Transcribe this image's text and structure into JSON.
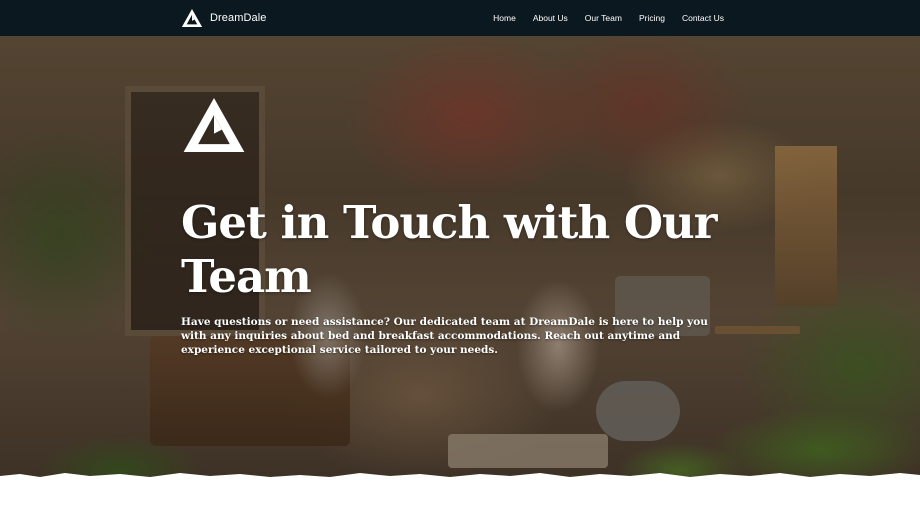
{
  "brand": {
    "name": "DreamDale",
    "logo_icon": "dreamdale-logo-icon"
  },
  "nav": {
    "links": [
      {
        "label": "Home"
      },
      {
        "label": "About Us"
      },
      {
        "label": "Our Team"
      },
      {
        "label": "Pricing"
      },
      {
        "label": "Contact Us"
      }
    ]
  },
  "hero": {
    "title": "Get in Touch with Our Team",
    "description": "Have questions or need assistance? Our dedicated team at DreamDale is here to help you with any inquiries about bed and breakfast accommodations. Reach out anytime and experience exceptional service tailored to your needs.",
    "background_description": "",
    "logo_icon": "dreamdale-logo-icon"
  },
  "colors": {
    "navbar_bg": "#0c1820",
    "text": "#ffffff",
    "page_bg": "#ffffff"
  }
}
